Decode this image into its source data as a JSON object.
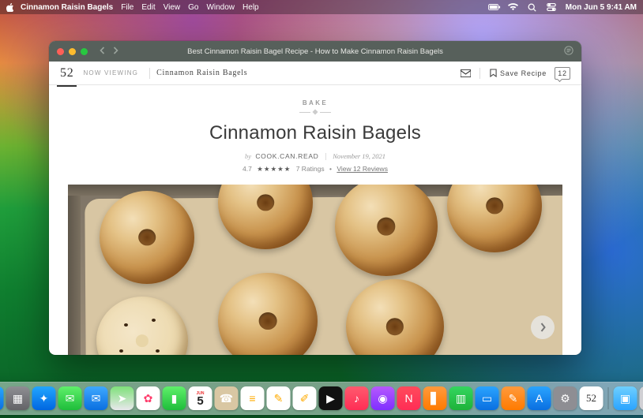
{
  "menubar": {
    "app_name": "Cinnamon Raisin Bagels",
    "items": [
      "File",
      "Edit",
      "View",
      "Go",
      "Window",
      "Help"
    ],
    "clock": "Mon Jun 5 9:41 AM"
  },
  "window": {
    "title": "Best Cinnamon Raisin Bagel Recipe - How to Make Cinnamon Raisin Bagels"
  },
  "site_header": {
    "logo": "52",
    "now_viewing_label": "NOW VIEWING",
    "crumb": "Cinnamon Raisin Bagels",
    "save_label": "Save Recipe",
    "comment_count": "12"
  },
  "article": {
    "category": "BAKE",
    "title": "Cinnamon Raisin Bagels",
    "by_label": "by",
    "author": "COOK.CAN.READ",
    "date": "November 19, 2021",
    "rating_value": "4.7",
    "stars": "★★★★★",
    "ratings_label": "7 Ratings",
    "reviews_link": "View 12 Reviews"
  },
  "dock": {
    "items": [
      {
        "name": "finder",
        "bg": "linear-gradient(180deg,#29a7ff,#0a6fe0)",
        "glyph": "☺"
      },
      {
        "name": "launchpad",
        "bg": "linear-gradient(180deg,#8e8e93,#636366)",
        "glyph": "▦"
      },
      {
        "name": "safari",
        "bg": "linear-gradient(180deg,#22a6ff,#0066e0)",
        "glyph": "✦"
      },
      {
        "name": "messages",
        "bg": "linear-gradient(180deg,#5ff06a,#1ebd3b)",
        "glyph": "✉"
      },
      {
        "name": "mail",
        "bg": "linear-gradient(180deg,#3ea8ff,#0a6fe0)",
        "glyph": "✉"
      },
      {
        "name": "maps",
        "bg": "linear-gradient(180deg,#7fe07a,#e8e8ec)",
        "glyph": "➤"
      },
      {
        "name": "photos",
        "bg": "#fff",
        "glyph": "✿"
      },
      {
        "name": "facetime",
        "bg": "linear-gradient(180deg,#5ff06a,#1ebd3b)",
        "glyph": "▮"
      },
      {
        "name": "calendar",
        "bg": "#fff",
        "glyph": "5"
      },
      {
        "name": "contacts",
        "bg": "#d9c7a3",
        "glyph": "☎"
      },
      {
        "name": "reminders",
        "bg": "#fff",
        "glyph": "≡"
      },
      {
        "name": "notes",
        "bg": "#fff",
        "glyph": "✎"
      },
      {
        "name": "freeform",
        "bg": "#fff",
        "glyph": "✐"
      },
      {
        "name": "tv",
        "bg": "#111",
        "glyph": "▶"
      },
      {
        "name": "music",
        "bg": "linear-gradient(180deg,#ff5a6e,#ff2d55)",
        "glyph": "♪"
      },
      {
        "name": "podcasts",
        "bg": "linear-gradient(180deg,#b659ff,#7f2fff)",
        "glyph": "◉"
      },
      {
        "name": "news",
        "bg": "linear-gradient(180deg,#ff4b5c,#ff2d55)",
        "glyph": "N"
      },
      {
        "name": "books",
        "bg": "linear-gradient(180deg,#ff9a3c,#ff7a00)",
        "glyph": "▋"
      },
      {
        "name": "numbers",
        "bg": "linear-gradient(180deg,#34d65f,#1eb23a)",
        "glyph": "▥"
      },
      {
        "name": "keynote",
        "bg": "linear-gradient(180deg,#2aa4ff,#0a6fe0)",
        "glyph": "▭"
      },
      {
        "name": "pages",
        "bg": "linear-gradient(180deg,#ff9a3c,#ff7a00)",
        "glyph": "✎"
      },
      {
        "name": "appstore",
        "bg": "linear-gradient(180deg,#2aa4ff,#0a6fe0)",
        "glyph": "A"
      },
      {
        "name": "settings",
        "bg": "#8e8e93",
        "glyph": "⚙"
      },
      {
        "name": "food52",
        "bg": "#fff",
        "glyph": "52"
      },
      {
        "name": "folder",
        "bg": "linear-gradient(180deg,#6ecfff,#2aa4ff)",
        "glyph": "▣"
      },
      {
        "name": "trash",
        "bg": "#d0d0d4",
        "glyph": "🗑"
      }
    ]
  }
}
